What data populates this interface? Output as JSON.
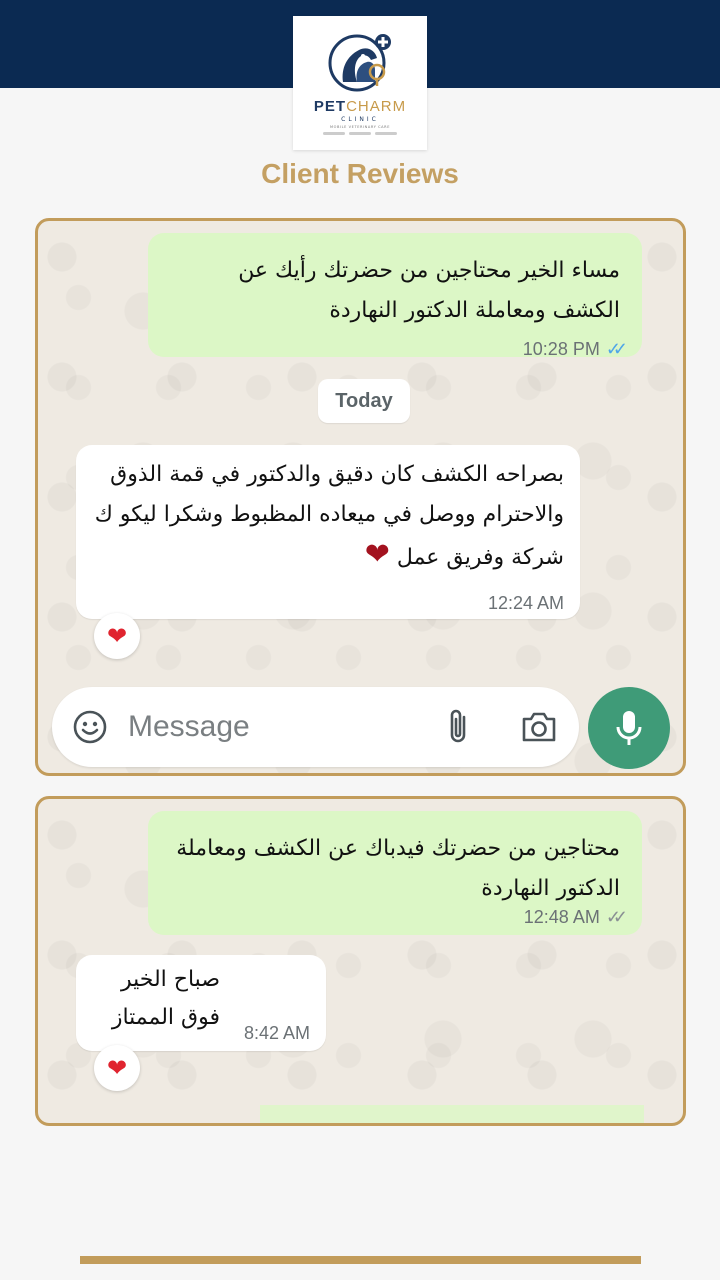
{
  "brand": {
    "name_part1": "PET",
    "name_part2": "CHARM",
    "subtitle": "CLINIC",
    "tagline": "MOBILE VETERINARY CARE"
  },
  "heading": "Client Reviews",
  "colors": {
    "header_bg": "#0b2a52",
    "accent_gold": "#c29c5b",
    "outgoing_bubble": "#dcf7c6",
    "incoming_bubble": "#ffffff",
    "mic_button": "#3f9b78",
    "read_ticks": "#4fa6e8"
  },
  "chat1": {
    "outgoing": {
      "text": "مساء الخير محتاجين من حضرتك رأيك عن الكشف ومعاملة الدكتور النهاردة",
      "time": "10:28 PM",
      "status_icon": "double-check-read-icon"
    },
    "day_label": "Today",
    "incoming": {
      "text": "بصراحه الكشف كان دقيق والدكتور في قمة الذوق والاحترام ووصل في ميعاده المظبوط وشكرا ليكو ك شركة وفريق عمل",
      "emoji": "❤",
      "time": "12:24 AM",
      "reaction": "❤"
    },
    "composer": {
      "placeholder": "Message",
      "emoji_icon": "emoji-icon",
      "attach_icon": "paperclip-icon",
      "camera_icon": "camera-icon",
      "mic_icon": "microphone-icon"
    }
  },
  "chat2": {
    "outgoing": {
      "text": "محتاجين من حضرتك فيدباك عن الكشف ومعاملة الدكتور النهاردة",
      "time": "12:48 AM",
      "status_icon": "double-check-delivered-icon"
    },
    "incoming": {
      "line1": "صباح الخير",
      "line2": "فوق الممتاز",
      "time": "8:42 AM",
      "reaction": "❤"
    }
  }
}
